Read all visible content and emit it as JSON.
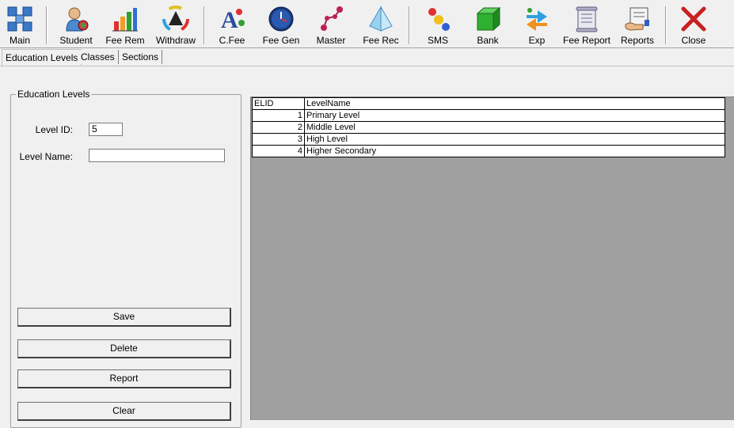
{
  "toolbar": {
    "items": [
      {
        "label": "Main",
        "icon": "main-grid-icon"
      },
      {
        "label": "Student",
        "icon": "student-icon"
      },
      {
        "label": "Fee Rem",
        "icon": "bar-chart-icon"
      },
      {
        "label": "Withdraw",
        "icon": "color-wheel-icon"
      },
      {
        "label": "C.Fee",
        "icon": "font-icon"
      },
      {
        "label": "Fee Gen",
        "icon": "clock-icon"
      },
      {
        "label": "Master",
        "icon": "nodes-icon"
      },
      {
        "label": "Fee Rec",
        "icon": "pyramid-icon"
      },
      {
        "label": "SMS",
        "icon": "molecule-icon"
      },
      {
        "label": "Bank",
        "icon": "green-box-icon"
      },
      {
        "label": "Exp",
        "icon": "exchange-arrows-icon"
      },
      {
        "label": "Fee Report",
        "icon": "scroll-icon"
      },
      {
        "label": "Reports",
        "icon": "report-hand-icon"
      },
      {
        "label": "Close",
        "icon": "close-x-icon"
      }
    ]
  },
  "tabs": [
    "Education Levels",
    "Classes",
    "Sections"
  ],
  "form": {
    "group_title": "Education Levels",
    "level_id_label": "Level ID:",
    "level_id_value": "5",
    "level_name_label": "Level Name:",
    "level_name_value": ""
  },
  "buttons": {
    "save": "Save",
    "delete": "Delete",
    "report": "Report",
    "clear": "Clear"
  },
  "grid": {
    "headers": [
      "ELID",
      "LevelName"
    ],
    "rows": [
      [
        "1",
        "Primary Level"
      ],
      [
        "2",
        "Middle Level"
      ],
      [
        "3",
        "High Level"
      ],
      [
        "4",
        "Higher Secondary"
      ]
    ]
  },
  "colors": {
    "accent_red": "#c00000",
    "grid_bg": "#a0a0a0",
    "window_bg": "#f0f0f0"
  }
}
